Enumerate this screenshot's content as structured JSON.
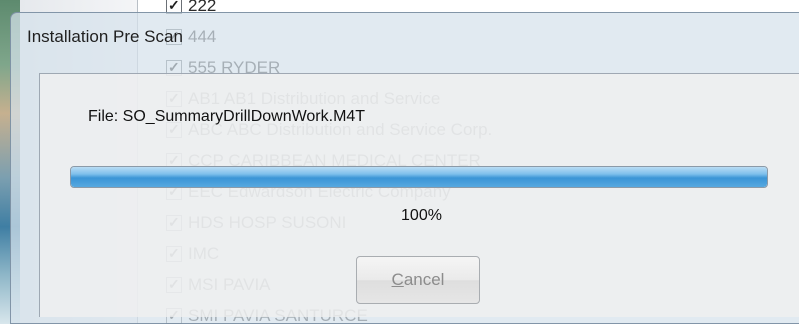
{
  "background_list": {
    "items": [
      {
        "label": "222"
      },
      {
        "label": "444"
      },
      {
        "label": "555 RYDER"
      },
      {
        "label": "AB1 AB1 Distribution and Service"
      },
      {
        "label": "ABC ABC Distribution and Service Corp."
      },
      {
        "label": "CCP CARIBBEAN MEDICAL CENTER"
      },
      {
        "label": "EEC Edwardson Electric Company"
      },
      {
        "label": "HDS HOSP SUSONI"
      },
      {
        "label": "IMC"
      },
      {
        "label": "MSI PAVIA"
      },
      {
        "label": "SMI PAVIA SANTURCE"
      }
    ]
  },
  "dialog": {
    "title": "Installation Pre Scan",
    "file_prefix": "File: ",
    "file_name": "SO_SummaryDrillDownWork.M4T",
    "progress_fraction": 1.0,
    "progress_text": "100%",
    "cancel_mnemonic": "C",
    "cancel_rest": "ancel"
  },
  "colors": {
    "progress_fill": "#3a95d6",
    "dialog_glass": "#d6e2ec"
  }
}
